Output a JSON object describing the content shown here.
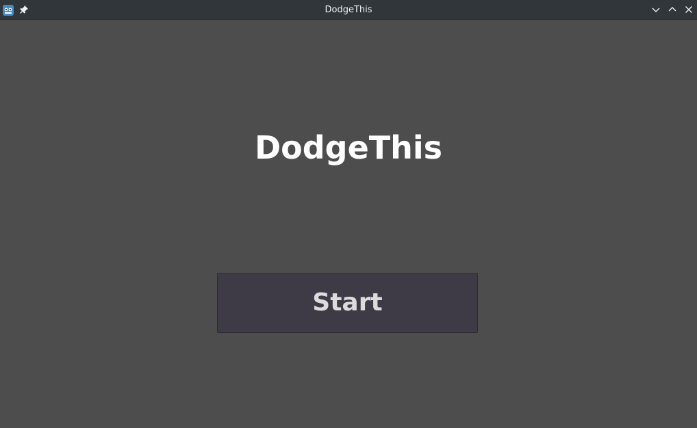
{
  "window": {
    "title": "DodgeThis",
    "app_icon": "godot-engine-icon",
    "pin_icon": "pin-icon",
    "controls": [
      "minimize-icon",
      "maximize-icon",
      "close-icon"
    ]
  },
  "game": {
    "title": "DodgeThis",
    "start_label": "Start"
  },
  "colors": {
    "titlebar": "#31363b",
    "background": "#4d4d4d",
    "button": "#3e3b47",
    "title_text": "#ffffff",
    "button_text": "#dcdcdc"
  }
}
